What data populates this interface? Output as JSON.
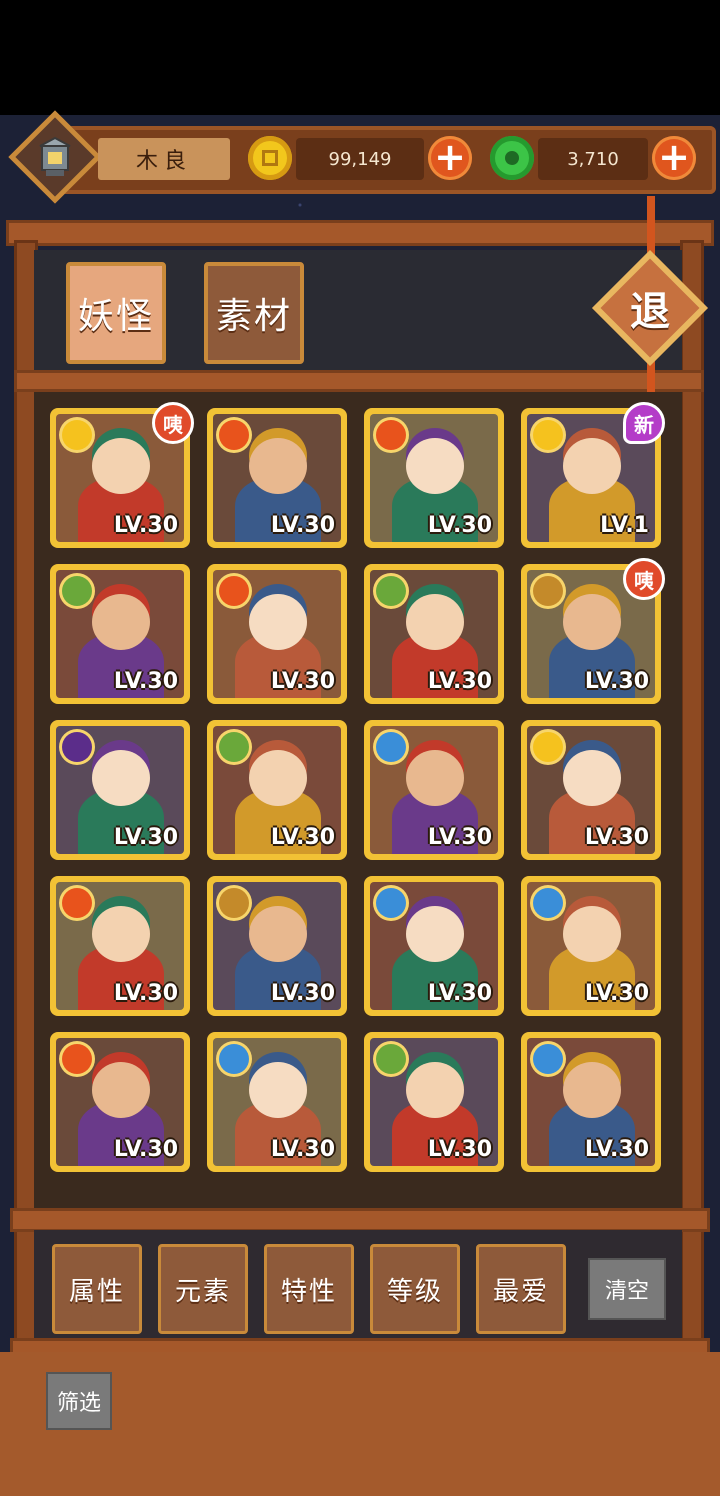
{
  "player": {
    "name": "木良",
    "avatar_icon": "lantern-icon"
  },
  "currency": {
    "coins": {
      "value": "99,149",
      "icon": "gold-coin-icon",
      "color": "#f2c71c"
    },
    "jade": {
      "value": "3,710",
      "icon": "green-jade-icon",
      "color": "#3cc447"
    },
    "plus_label": "+"
  },
  "tabs": [
    {
      "label": "妖怪",
      "active": true
    },
    {
      "label": "素材",
      "active": false
    }
  ],
  "exit_label": "退",
  "cards": [
    {
      "element": "light",
      "level": "LV.30",
      "badge": "咦"
    },
    {
      "element": "fire",
      "level": "LV.30",
      "badge": ""
    },
    {
      "element": "fire",
      "level": "LV.30",
      "badge": ""
    },
    {
      "element": "light",
      "level": "LV.1",
      "badge": "新"
    },
    {
      "element": "wood",
      "level": "LV.30",
      "badge": ""
    },
    {
      "element": "fire",
      "level": "LV.30",
      "badge": ""
    },
    {
      "element": "wood",
      "level": "LV.30",
      "badge": ""
    },
    {
      "element": "earth",
      "level": "LV.30",
      "badge": "咦"
    },
    {
      "element": "dark",
      "level": "LV.30",
      "badge": ""
    },
    {
      "element": "wood",
      "level": "LV.30",
      "badge": ""
    },
    {
      "element": "water",
      "level": "LV.30",
      "badge": ""
    },
    {
      "element": "light",
      "level": "LV.30",
      "badge": ""
    },
    {
      "element": "fire",
      "level": "LV.30",
      "badge": ""
    },
    {
      "element": "earth",
      "level": "LV.30",
      "badge": ""
    },
    {
      "element": "water",
      "level": "LV.30",
      "badge": ""
    },
    {
      "element": "water",
      "level": "LV.30",
      "badge": ""
    },
    {
      "element": "fire",
      "level": "LV.30",
      "badge": ""
    },
    {
      "element": "water",
      "level": "LV.30",
      "badge": ""
    },
    {
      "element": "wood",
      "level": "LV.30",
      "badge": ""
    },
    {
      "element": "water",
      "level": "LV.30",
      "badge": ""
    }
  ],
  "element_colors": {
    "light": "#f5c21e",
    "fire": "#e8531c",
    "wood": "#6aa83a",
    "earth": "#c48a2a",
    "dark": "#5b2d8a",
    "water": "#3a8ed8"
  },
  "filters": {
    "attribute": "属性",
    "element": "元素",
    "trait": "特性",
    "level": "等级",
    "favorite": "最爱",
    "clear": "清空"
  },
  "screen_label": "筛选"
}
